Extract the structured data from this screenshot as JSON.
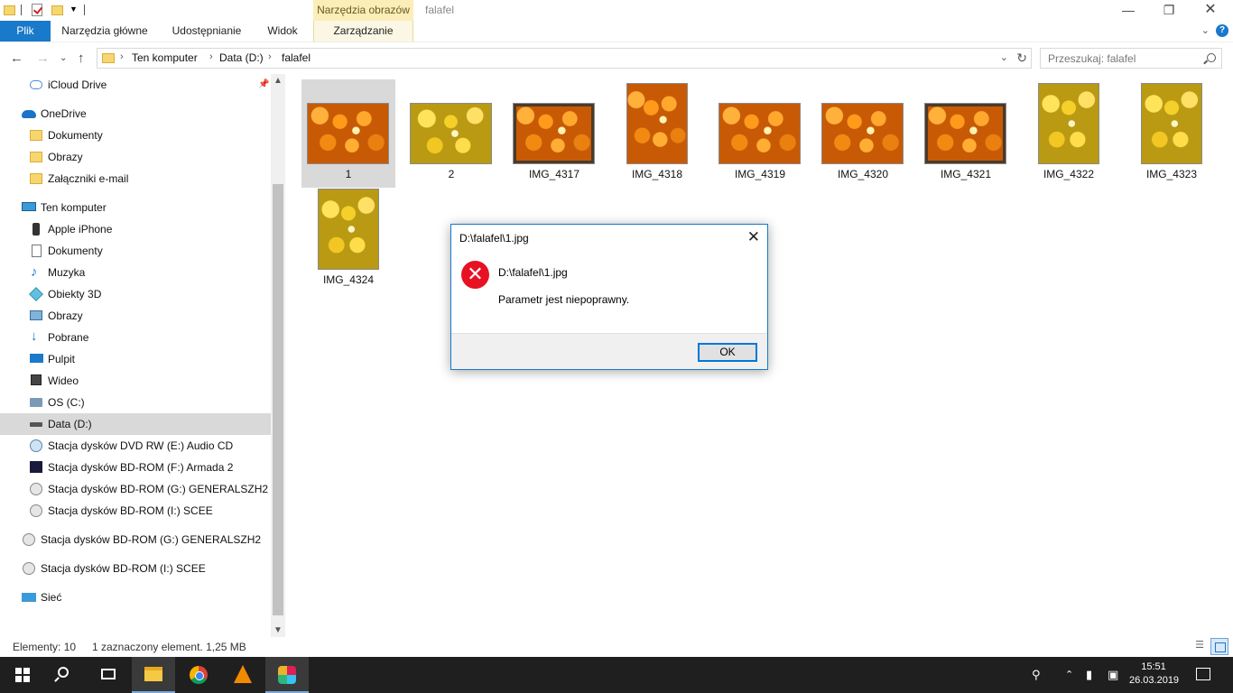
{
  "window": {
    "title": "falafel",
    "context_tab_header": "Narzędzia obrazów",
    "controls": [
      "minimize",
      "maximize",
      "close"
    ]
  },
  "ribbon": {
    "tabs": [
      {
        "label": "Plik",
        "active": true
      },
      {
        "label": "Narzędzia główne"
      },
      {
        "label": "Udostępnianie"
      },
      {
        "label": "Widok"
      },
      {
        "label": "Zarządzanie"
      }
    ]
  },
  "address": {
    "breadcrumbs": [
      "Ten komputer",
      "Data (D:)",
      "falafel"
    ],
    "search_placeholder": "Przeszukaj: falafel"
  },
  "nav": {
    "items": [
      {
        "label": "iCloud Drive",
        "icon": "icloud-icon"
      },
      {
        "label": "OneDrive",
        "icon": "onedrive-icon"
      },
      {
        "label": "Dokumenty",
        "icon": "folder-icon"
      },
      {
        "label": "Obrazy",
        "icon": "folder-icon"
      },
      {
        "label": "Załączniki e-mail",
        "icon": "folder-icon"
      },
      {
        "label": "Ten komputer",
        "icon": "computer-icon"
      },
      {
        "label": "Apple iPhone",
        "icon": "phone-icon"
      },
      {
        "label": "Dokumenty",
        "icon": "documents-icon"
      },
      {
        "label": "Muzyka",
        "icon": "music-icon"
      },
      {
        "label": "Obiekty 3D",
        "icon": "3d-objects-icon"
      },
      {
        "label": "Obrazy",
        "icon": "pictures-icon"
      },
      {
        "label": "Pobrane",
        "icon": "downloads-icon"
      },
      {
        "label": "Pulpit",
        "icon": "desktop-icon"
      },
      {
        "label": "Wideo",
        "icon": "video-icon"
      },
      {
        "label": "OS (C:)",
        "icon": "os-drive-icon"
      },
      {
        "label": "Data (D:)",
        "icon": "drive-icon",
        "selected": true
      },
      {
        "label": "Stacja dysków DVD RW (E:) Audio CD",
        "icon": "dvd-icon"
      },
      {
        "label": "Stacja dysków BD-ROM (F:) Armada 2",
        "icon": "armada-icon"
      },
      {
        "label": "Stacja dysków BD-ROM (G:) GENERALSZH2",
        "icon": "bd-drive-icon"
      },
      {
        "label": "Stacja dysków BD-ROM (I:) SCEE",
        "icon": "disc-icon"
      },
      {
        "label": "Stacja dysków BD-ROM (G:) GENERALSZH2",
        "icon": "bd-drive-icon"
      },
      {
        "label": "Stacja dysków BD-ROM (I:) SCEE",
        "icon": "disc-icon"
      },
      {
        "label": "Sieć",
        "icon": "network-icon"
      }
    ]
  },
  "files": [
    {
      "name": "1",
      "selected": true
    },
    {
      "name": "2"
    },
    {
      "name": "IMG_4317"
    },
    {
      "name": "IMG_4318"
    },
    {
      "name": "IMG_4319"
    },
    {
      "name": "IMG_4320"
    },
    {
      "name": "IMG_4321"
    },
    {
      "name": "IMG_4322"
    },
    {
      "name": "IMG_4323"
    },
    {
      "name": "IMG_4324"
    }
  ],
  "dialog": {
    "title": "D:\\falafel\\1.jpg",
    "file": "D:\\falafel\\1.jpg",
    "message": "Parametr jest niepoprawny.",
    "ok_label": "OK",
    "icon": "error-icon"
  },
  "status": {
    "count": "Elementy: 10",
    "selection": "1 zaznaczony element. 1,25 MB"
  },
  "taskbar": {
    "time": "15:51",
    "date": "26.03.2019"
  },
  "colors": {
    "accent": "#1979ca",
    "context_tab": "#fbeeb8",
    "error": "#e81123",
    "selection": "#d9d9d9",
    "taskbar": "#1f1f1f"
  }
}
